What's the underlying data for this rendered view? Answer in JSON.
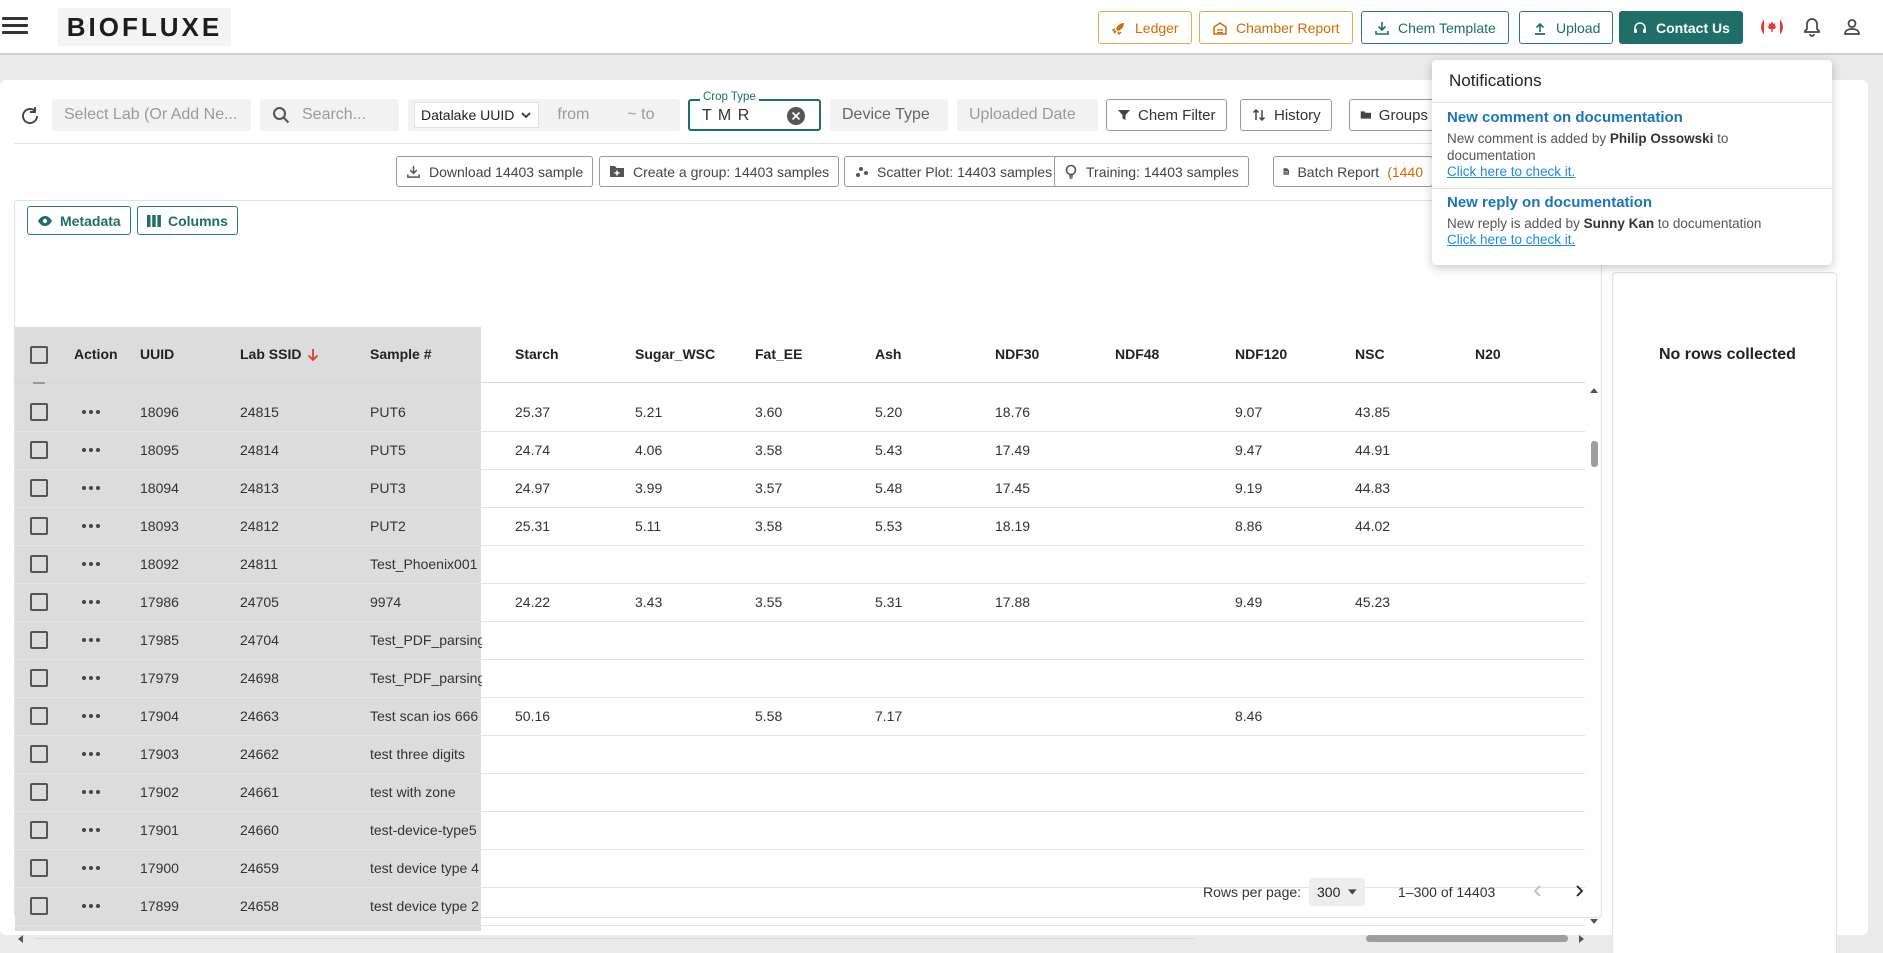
{
  "header": {
    "logo": "BIOFLUXE",
    "buttons": {
      "ledger": "Ledger",
      "chamber_report": "Chamber Report",
      "chem_template": "Chem Template",
      "upload": "Upload",
      "contact_us": "Contact Us"
    },
    "icons": [
      "menu-icon",
      "rocket-icon",
      "chamber-icon",
      "download-icon",
      "upload-icon",
      "headset-icon",
      "canada-flag-icon",
      "bell-icon",
      "user-icon"
    ]
  },
  "filters": {
    "lab_placeholder": "Select Lab (Or Add Ne...",
    "search_placeholder": "Search...",
    "datalake_select": "Datalake UUID",
    "from_placeholder": "from",
    "to_placeholder": "~ to",
    "crop_type_label": "Crop Type",
    "crop_type_value": "T M R",
    "device_type_placeholder": "Device Type",
    "uploaded_date_placeholder": "Uploaded Date",
    "chem_filter": "Chem Filter",
    "history": "History",
    "groups": "Groups"
  },
  "actions": {
    "download": "Download 14403 sample",
    "create_group": "Create a group: 14403 samples",
    "scatter_plot": "Scatter Plot: 14403 samples",
    "training": "Training: 14403 samples",
    "batch_report": "Batch Report",
    "batch_report_count": "(1440"
  },
  "grid_controls": {
    "metadata": "Metadata",
    "columns": "Columns"
  },
  "table": {
    "columns": [
      "Action",
      "UUID",
      "Lab SSID",
      "Sample #",
      "Starch",
      "Sugar_WSC",
      "Fat_EE",
      "Ash",
      "NDF30",
      "NDF48",
      "NDF120",
      "NSC",
      "N20"
    ],
    "rows": [
      {
        "uuid": "18096",
        "ssid": "24815",
        "sample": "PUT6",
        "starch": "25.37",
        "sugar": "5.21",
        "fat": "3.60",
        "ash": "5.20",
        "ndf30": "18.76",
        "ndf48": "",
        "ndf120": "9.07",
        "nsc": "43.85",
        "n20": ""
      },
      {
        "uuid": "18095",
        "ssid": "24814",
        "sample": "PUT5",
        "starch": "24.74",
        "sugar": "4.06",
        "fat": "3.58",
        "ash": "5.43",
        "ndf30": "17.49",
        "ndf48": "",
        "ndf120": "9.47",
        "nsc": "44.91",
        "n20": ""
      },
      {
        "uuid": "18094",
        "ssid": "24813",
        "sample": "PUT3",
        "starch": "24.97",
        "sugar": "3.99",
        "fat": "3.57",
        "ash": "5.48",
        "ndf30": "17.45",
        "ndf48": "",
        "ndf120": "9.19",
        "nsc": "44.83",
        "n20": ""
      },
      {
        "uuid": "18093",
        "ssid": "24812",
        "sample": "PUT2",
        "starch": "25.31",
        "sugar": "5.11",
        "fat": "3.58",
        "ash": "5.53",
        "ndf30": "18.19",
        "ndf48": "",
        "ndf120": "8.86",
        "nsc": "44.02",
        "n20": ""
      },
      {
        "uuid": "18092",
        "ssid": "24811",
        "sample": "Test_Phoenix001",
        "starch": "",
        "sugar": "",
        "fat": "",
        "ash": "",
        "ndf30": "",
        "ndf48": "",
        "ndf120": "",
        "nsc": "",
        "n20": ""
      },
      {
        "uuid": "17986",
        "ssid": "24705",
        "sample": "9974",
        "starch": "24.22",
        "sugar": "3.43",
        "fat": "3.55",
        "ash": "5.31",
        "ndf30": "17.88",
        "ndf48": "",
        "ndf120": "9.49",
        "nsc": "45.23",
        "n20": ""
      },
      {
        "uuid": "17985",
        "ssid": "24704",
        "sample": "Test_PDF_parsing",
        "starch": "",
        "sugar": "",
        "fat": "",
        "ash": "",
        "ndf30": "",
        "ndf48": "",
        "ndf120": "",
        "nsc": "",
        "n20": ""
      },
      {
        "uuid": "17979",
        "ssid": "24698",
        "sample": "Test_PDF_parsing",
        "starch": "",
        "sugar": "",
        "fat": "",
        "ash": "",
        "ndf30": "",
        "ndf48": "",
        "ndf120": "",
        "nsc": "",
        "n20": ""
      },
      {
        "uuid": "17904",
        "ssid": "24663",
        "sample": "Test scan ios 666",
        "starch": "50.16",
        "sugar": "",
        "fat": "5.58",
        "ash": "7.17",
        "ndf30": "",
        "ndf48": "",
        "ndf120": "8.46",
        "nsc": "",
        "n20": ""
      },
      {
        "uuid": "17903",
        "ssid": "24662",
        "sample": "test three digits",
        "starch": "",
        "sugar": "",
        "fat": "",
        "ash": "",
        "ndf30": "",
        "ndf48": "",
        "ndf120": "",
        "nsc": "",
        "n20": ""
      },
      {
        "uuid": "17902",
        "ssid": "24661",
        "sample": "test with zone",
        "starch": "",
        "sugar": "",
        "fat": "",
        "ash": "",
        "ndf30": "",
        "ndf48": "",
        "ndf120": "",
        "nsc": "",
        "n20": ""
      },
      {
        "uuid": "17901",
        "ssid": "24660",
        "sample": "test-device-type5",
        "starch": "",
        "sugar": "",
        "fat": "",
        "ash": "",
        "ndf30": "",
        "ndf48": "",
        "ndf120": "",
        "nsc": "",
        "n20": ""
      },
      {
        "uuid": "17900",
        "ssid": "24659",
        "sample": "test device type 4",
        "starch": "",
        "sugar": "",
        "fat": "",
        "ash": "",
        "ndf30": "",
        "ndf48": "",
        "ndf120": "",
        "nsc": "",
        "n20": ""
      },
      {
        "uuid": "17899",
        "ssid": "24658",
        "sample": "test device type 2",
        "starch": "",
        "sugar": "",
        "fat": "",
        "ash": "",
        "ndf30": "",
        "ndf48": "",
        "ndf120": "",
        "nsc": "",
        "n20": ""
      }
    ]
  },
  "pagination": {
    "rows_per_page_label": "Rows per page:",
    "rows_per_page": "300",
    "range": "1–300 of 14403"
  },
  "collected": {
    "empty_text": "No rows collected"
  },
  "notifications": {
    "title": "Notifications",
    "items": [
      {
        "title": "New comment on documentation",
        "prefix": "New comment is added by",
        "user": "Philip Ossowski",
        "suffix": "to documentation",
        "link": "Click here to check it."
      },
      {
        "title": "New reply on documentation",
        "prefix": "New reply is added by",
        "user": "Sunny Kan",
        "suffix": "to documentation",
        "link": "Click here to check it."
      }
    ]
  },
  "colors": {
    "teal": "#1f6e67",
    "orange": "#d46b00",
    "sort_arrow": "#e53935",
    "link": "#1976b8"
  }
}
